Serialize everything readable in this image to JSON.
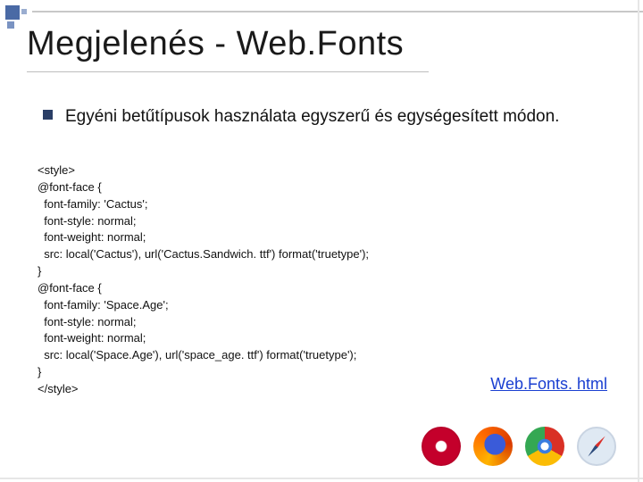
{
  "title": "Megjelenés - Web.Fonts",
  "bullet": {
    "text": "Egyéni betűtípusok használata egyszerű és egységesített módon."
  },
  "code": "<style>\n@font-face {\n  font-family: 'Cactus';\n  font-style: normal;\n  font-weight: normal;\n  src: local('Cactus'), url('Cactus.Sandwich. ttf') format('truetype');\n}\n@font-face {\n  font-family: 'Space.Age';\n  font-style: normal;\n  font-weight: normal;\n  src: local('Space.Age'), url('space_age. ttf') format('truetype');\n}\n</style>",
  "link": {
    "label": "Web.Fonts. html"
  },
  "icons": {
    "opera": "opera-icon",
    "firefox": "firefox-icon",
    "chrome": "chrome-icon",
    "safari": "safari-icon"
  }
}
